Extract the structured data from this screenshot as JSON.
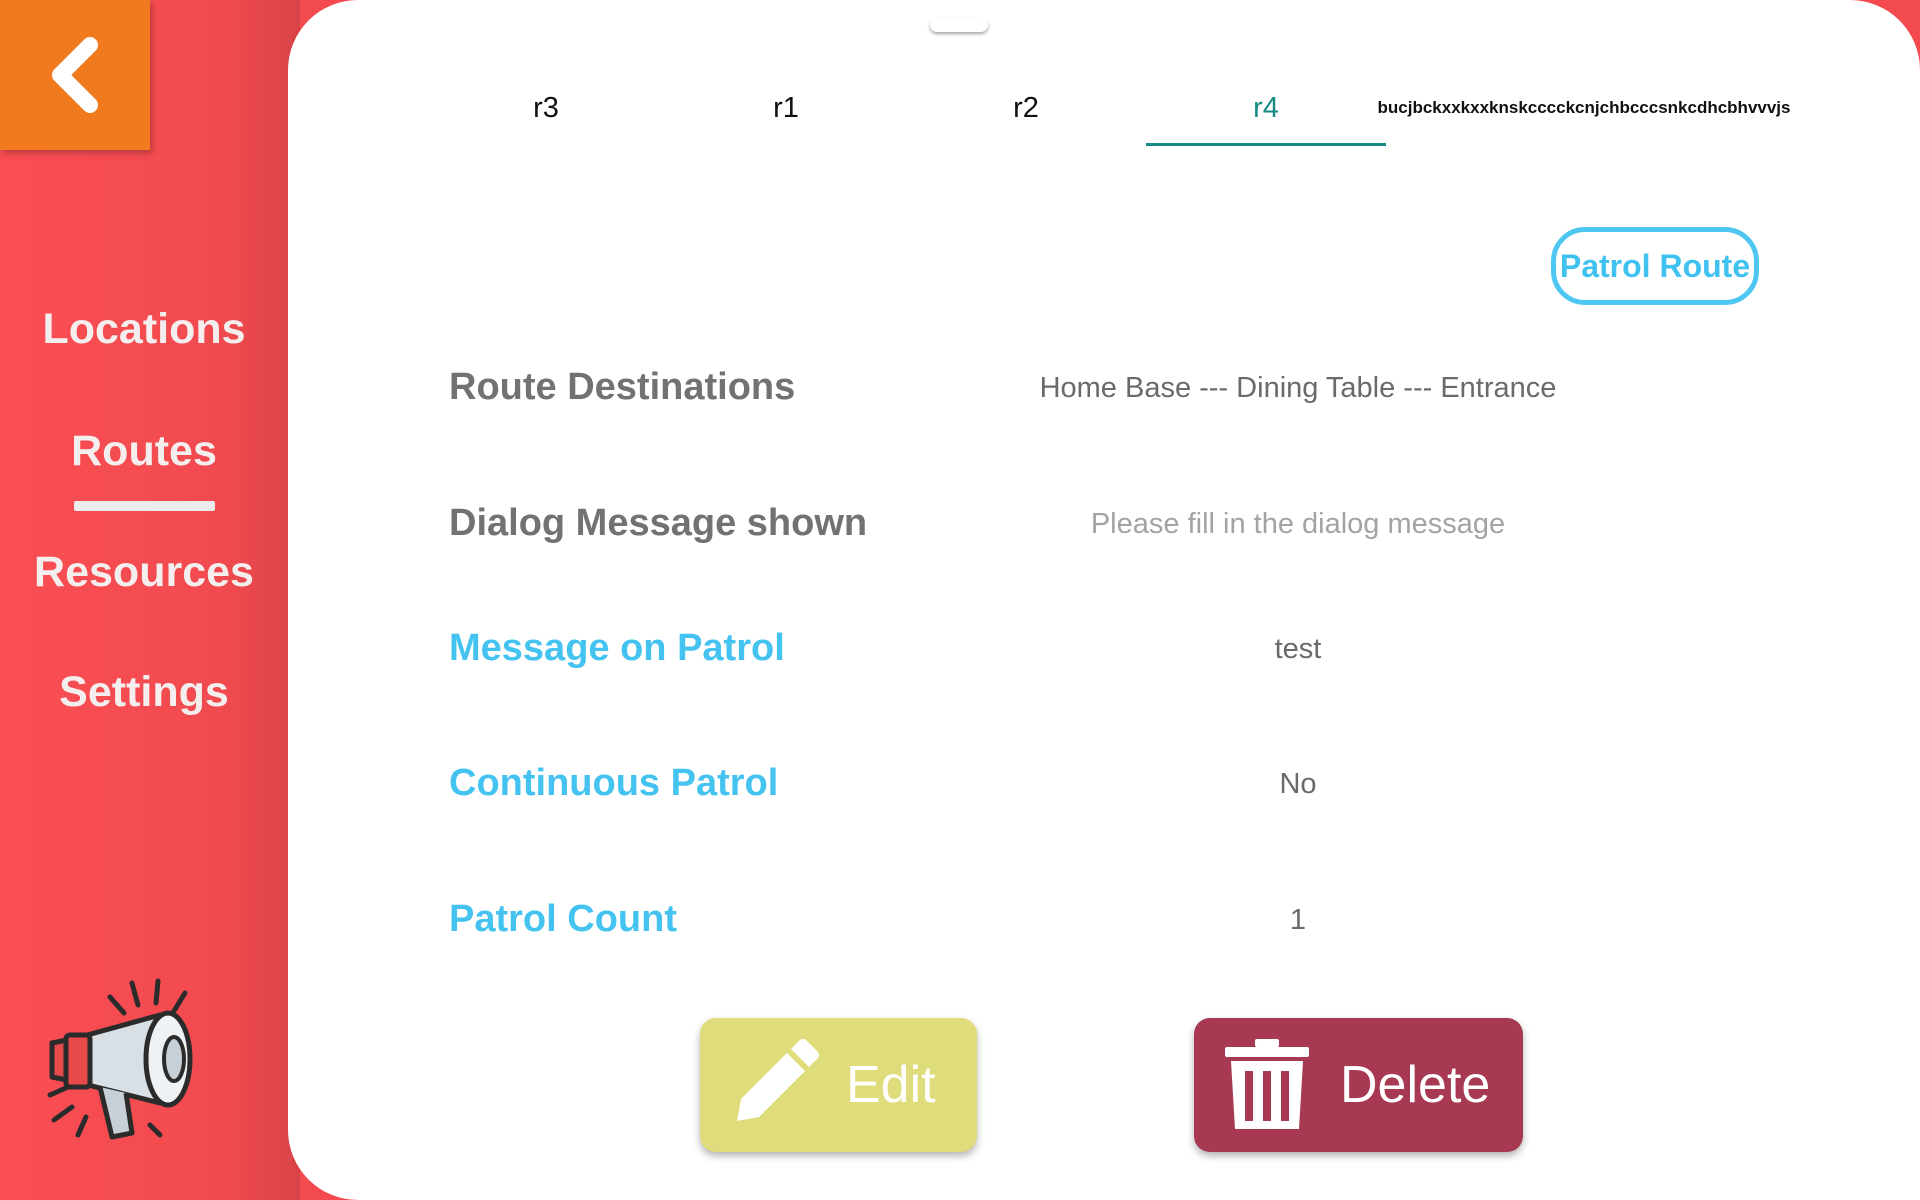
{
  "sidebar": {
    "items": [
      {
        "label": "Locations"
      },
      {
        "label": "Routes",
        "active": true
      },
      {
        "label": "Resources"
      },
      {
        "label": "Settings"
      }
    ]
  },
  "tabs": [
    {
      "label": "r3"
    },
    {
      "label": "r1"
    },
    {
      "label": "r2"
    },
    {
      "label": "r4",
      "active": true
    },
    {
      "label": "bucjbckxxkxxknskcccckcnjchbcccsnkcdhcbhvvvjs"
    }
  ],
  "patrol_route_button": "Patrol Route",
  "details": {
    "route_destinations": {
      "label": "Route Destinations",
      "value": "Home Base --- Dining Table --- Entrance"
    },
    "dialog_message": {
      "label": "Dialog Message shown",
      "placeholder": "Please fill in the dialog message"
    },
    "message_on_patrol": {
      "label": "Message on Patrol",
      "value": "test"
    },
    "continuous_patrol": {
      "label": "Continuous Patrol",
      "value": "No"
    },
    "patrol_count": {
      "label": "Patrol Count",
      "value": "1"
    }
  },
  "actions": {
    "edit": "Edit",
    "delete": "Delete"
  },
  "colors": {
    "sidebar": "#f24a4e",
    "back_button": "#f07a1d",
    "active_tab": "#158a84",
    "accent_blue": "#45c3f0",
    "edit_button": "#dfdc7c",
    "delete_button": "#a73a52"
  },
  "icons": {
    "back": "chevron-left-icon",
    "megaphone": "megaphone-icon",
    "edit": "pencil-icon",
    "delete": "trash-icon"
  }
}
